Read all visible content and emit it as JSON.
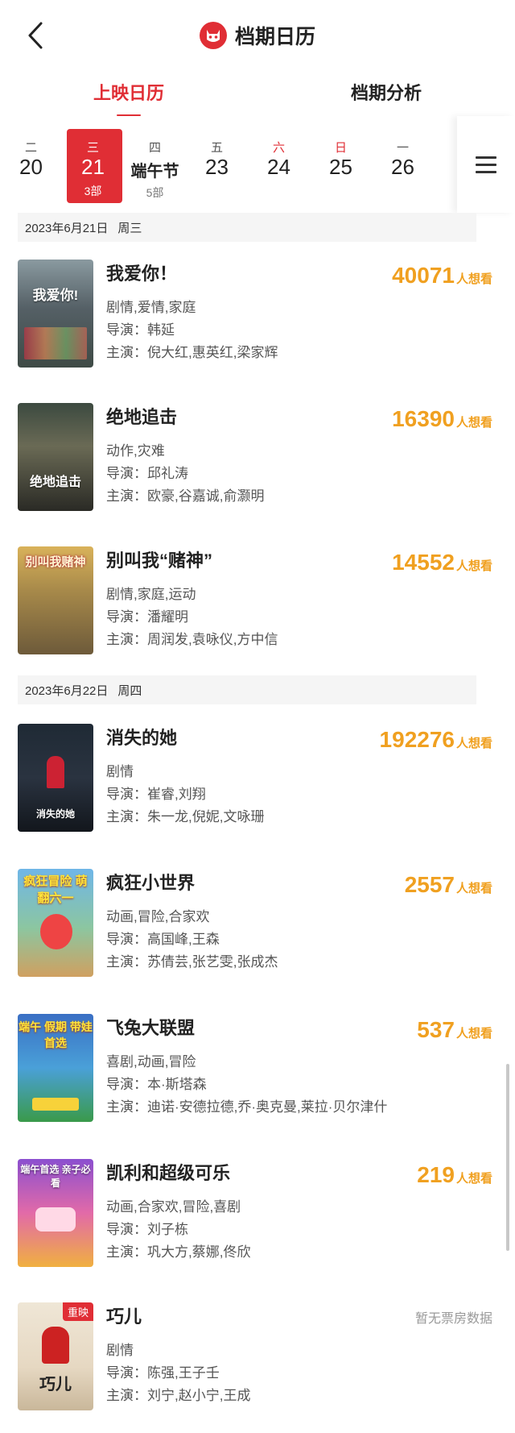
{
  "header": {
    "back_icon": "chevron-left-icon",
    "logo_icon": "maoyan-cat-icon",
    "title": "档期日历",
    "brand_color": "#e02e35"
  },
  "tabs": [
    {
      "label": "上映日历",
      "active": true
    },
    {
      "label": "档期分析",
      "active": false
    }
  ],
  "days": [
    {
      "dow": "二",
      "num": "20",
      "count": "",
      "selected": false,
      "red": false
    },
    {
      "dow": "三",
      "num": "21",
      "count": "3部",
      "selected": true,
      "red": false
    },
    {
      "dow": "四",
      "num": "端午节",
      "count": "5部",
      "selected": false,
      "red": false
    },
    {
      "dow": "五",
      "num": "23",
      "count": "",
      "selected": false,
      "red": false
    },
    {
      "dow": "六",
      "num": "24",
      "count": "",
      "selected": false,
      "red": true
    },
    {
      "dow": "日",
      "num": "25",
      "count": "",
      "selected": false,
      "red": true
    },
    {
      "dow": "一",
      "num": "26",
      "count": "",
      "selected": false,
      "red": false
    }
  ],
  "menu_icon": "hamburger-menu-icon",
  "sections": [
    {
      "date": "2023年6月21日",
      "weekday": "周三"
    },
    {
      "date": "2023年6月22日",
      "weekday": "周四"
    }
  ],
  "labels": {
    "director": "导演：",
    "cast": "主演：",
    "want_unit": "人想看"
  },
  "movies": [
    {
      "title": "我爱你！",
      "genre": "剧情,爱情,家庭",
      "director": "韩延",
      "cast": "倪大红,惠英红,梁家辉",
      "want": "40071",
      "poster_text": "我爱你!"
    },
    {
      "title": "绝地追击",
      "genre": "动作,灾难",
      "director": "邱礼涛",
      "cast": "欧豪,谷嘉诚,俞灏明",
      "want": "16390",
      "poster_text": "绝地追击"
    },
    {
      "title": "别叫我“赌神”",
      "genre": "剧情,家庭,运动",
      "director": "潘耀明",
      "cast": "周润发,袁咏仪,方中信",
      "want": "14552",
      "poster_text": "别叫我赌神"
    },
    {
      "title": "消失的她",
      "genre": "剧情",
      "director": "崔睿,刘翔",
      "cast": "朱一龙,倪妮,文咏珊",
      "want": "192276",
      "poster_text": "消失的她"
    },
    {
      "title": "疯狂小世界",
      "genre": "动画,冒险,合家欢",
      "director": "高国峰,王森",
      "cast": "苏倩芸,张艺雯,张成杰",
      "want": "2557",
      "poster_text": "疯狂冒险 萌翻六一"
    },
    {
      "title": "飞兔大联盟",
      "genre": "喜剧,动画,冒险",
      "director": "本·斯塔森",
      "cast": "迪诺·安德拉德,乔·奥克曼,莱拉·贝尔津什",
      "want": "537",
      "poster_text": "端午 假期 带娃 首选"
    },
    {
      "title": "凯利和超级可乐",
      "genre": "动画,合家欢,冒险,喜剧",
      "director": "刘子栋",
      "cast": "巩大方,蔡娜,佟欣",
      "want": "219",
      "poster_text": "端午首选 亲子必看"
    },
    {
      "title": "巧儿",
      "genre": "剧情",
      "director": "陈强,王子壬",
      "cast": "刘宁,赵小宁,王成",
      "want": "",
      "no_data": "暂无票房数据",
      "badge": "重映",
      "poster_text": "巧儿"
    }
  ]
}
